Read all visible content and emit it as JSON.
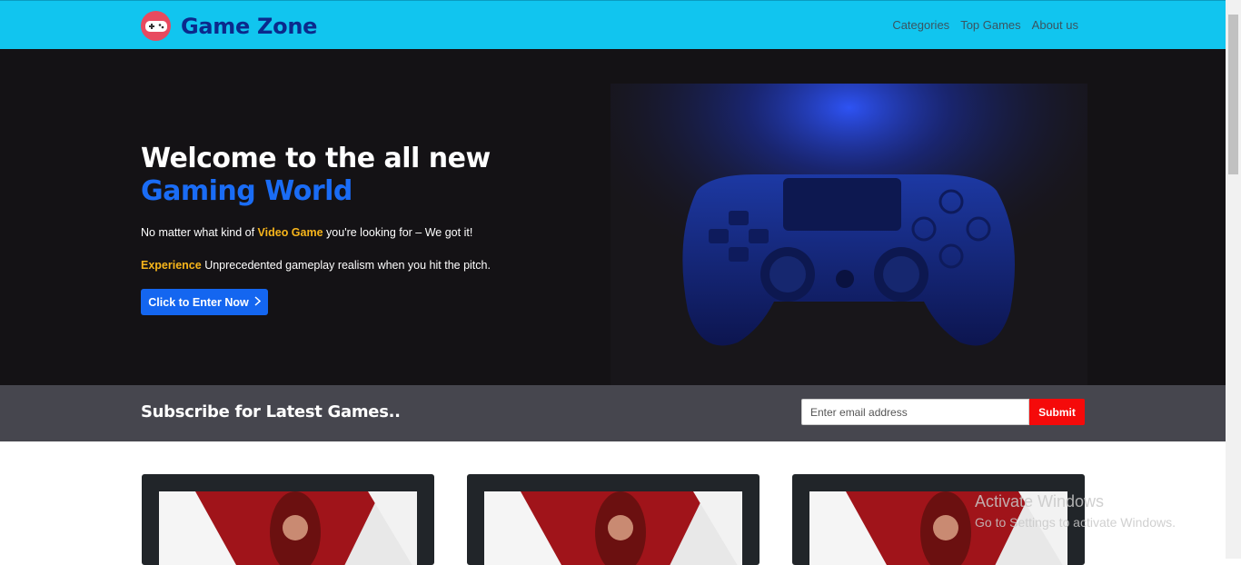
{
  "navbar": {
    "brand": "Game Zone",
    "links": [
      "Categories",
      "Top Games",
      "About us"
    ]
  },
  "hero": {
    "title_part1": "Welcome to the all new ",
    "title_accent": "Gaming World",
    "p1_pre": "No matter what kind of ",
    "p1_highlight": "Video Game",
    "p1_post": " you're looking for – We got it!",
    "p2_highlight": "Experience",
    "p2_post": " Unprecedented gameplay realism when you hit the pitch.",
    "cta_label": "Click to Enter Now"
  },
  "subscribe": {
    "title": "Subscribe for Latest Games..",
    "placeholder": "Enter email address",
    "submit_label": "Submit"
  },
  "watermark": {
    "line1": "Activate Windows",
    "line2": "Go to Settings to activate Windows."
  },
  "colors": {
    "navbar_bg": "#11c5ef",
    "brand_text": "#0b2a8c",
    "accent_blue": "#1a6cf5",
    "highlight_yellow": "#f7b51b",
    "submit_red": "#f50a0a"
  }
}
